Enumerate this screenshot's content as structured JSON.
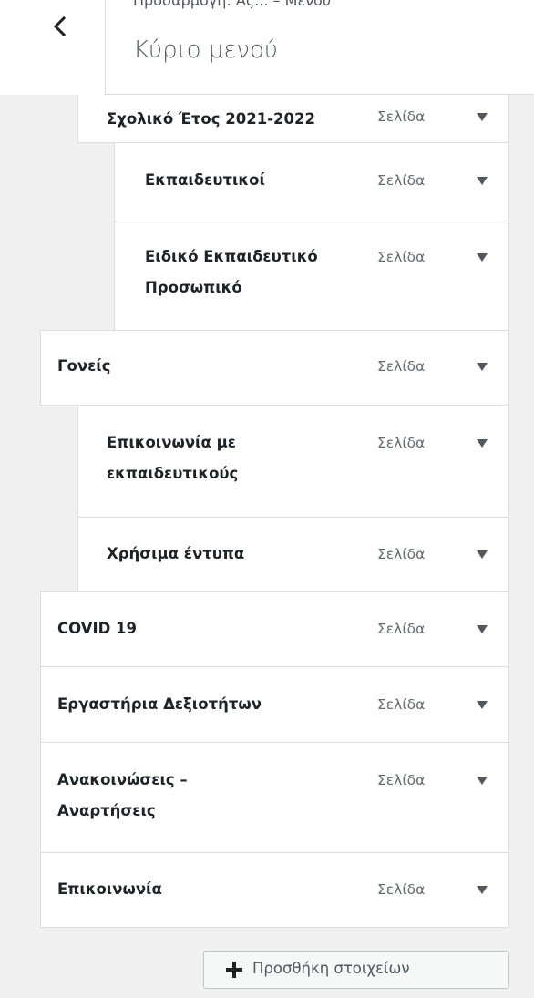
{
  "header": {
    "breadcrumb": "Προσαρμογή: Ας... – Μενού",
    "title": "Κύριο μενού"
  },
  "menu": {
    "items": [
      {
        "title": "Σχολικό Έτος 2021-2022",
        "type": "Σελίδα"
      },
      {
        "title": "Εκπαιδευτικοί",
        "type": "Σελίδα"
      },
      {
        "title": "Ειδικό Εκπαιδευτικό",
        "title2": "Προσωπικό",
        "type": "Σελίδα"
      },
      {
        "title": "Γονείς",
        "type": "Σελίδα"
      },
      {
        "title": "Επικοινωνία με",
        "title2": "εκπαιδευτικούς",
        "type": "Σελίδα"
      },
      {
        "title": "Χρήσιμα έντυπα",
        "type": "Σελίδα"
      },
      {
        "title": "COVID 19",
        "type": "Σελίδα"
      },
      {
        "title": "Εργαστήρια Δεξιοτήτων",
        "type": "Σελίδα"
      },
      {
        "title": "Ανακοινώσεις –",
        "title2": "Αναρτήσεις",
        "type": "Σελίδα"
      },
      {
        "title": "Επικοινωνία",
        "type": "Σελίδα"
      }
    ]
  },
  "footer": {
    "add_label": "Προσθήκη στοιχείων"
  },
  "colors": {
    "background": "#f0f0f1",
    "item_background": "#ffffff",
    "border": "#dcdcde",
    "text": "#1d2327",
    "muted_text": "#646970"
  }
}
